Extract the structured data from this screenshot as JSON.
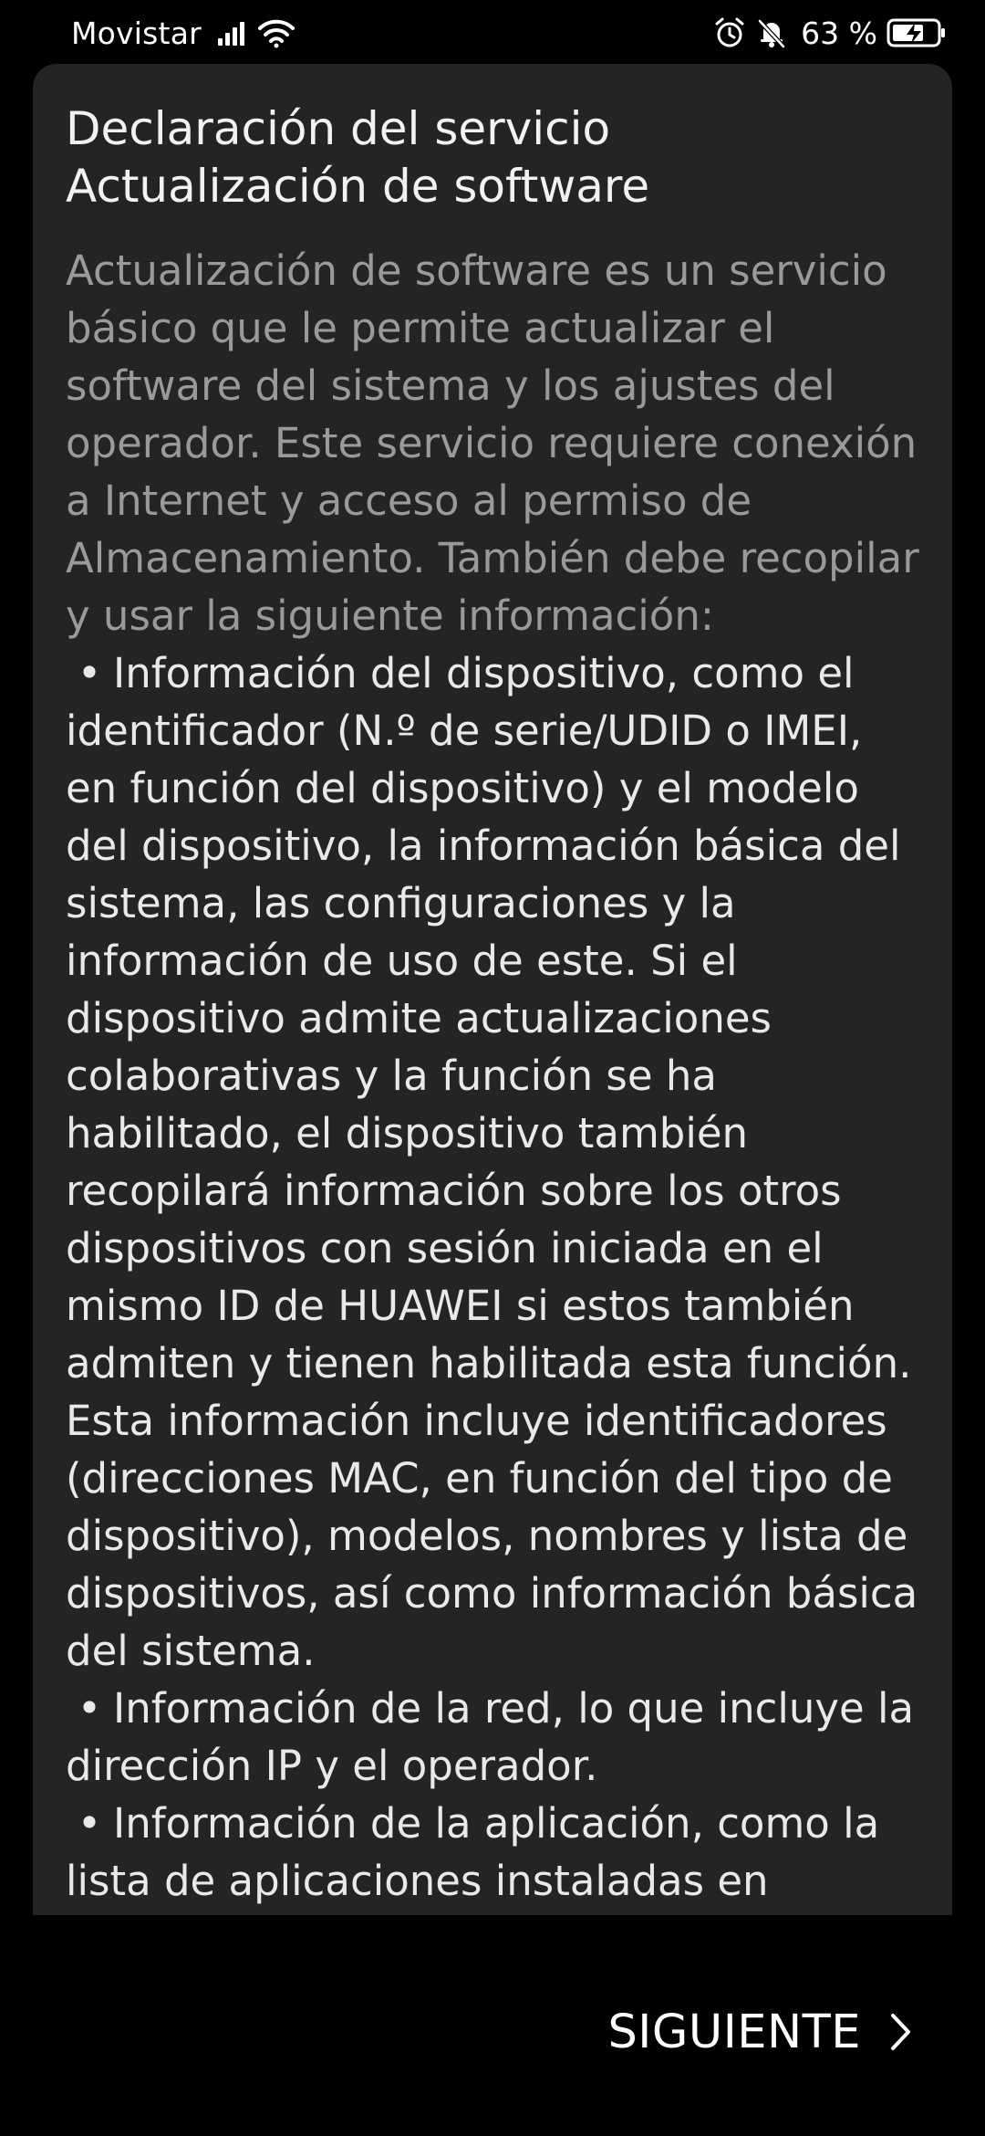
{
  "status_bar": {
    "carrier": "Movistar",
    "battery_percent": "63 %"
  },
  "dialog": {
    "title": "Declaración del servicio\nActualización de software",
    "intro": "Actualización de software es un servicio básico que le permite actualizar el software del sistema y los ajustes del operador. Este servicio requiere conexión a Internet y acceso al permiso de Almacenamiento. También debe recopilar y usar la siguiente información:",
    "bullet_symbol": "•",
    "bullets": [
      "Información del dispositivo, como el identificador (N.º de serie/UDID o IMEI, en función del dispositivo) y el modelo del dispositivo, la información básica del sistema, las configuraciones y la información de uso de este. Si el dispositivo admite actualizaciones colaborativas y la función se ha habilitado, el dispositivo también recopilará información sobre los otros dispositivos con sesión iniciada en el mismo ID de HUAWEI si estos también admiten y tienen habilitada esta función. Esta información incluye identificadores (direcciones MAC, en función del tipo de dispositivo), modelos, nombres y lista de dispositivos, así como información básica del sistema.",
      "Información de la red, lo que incluye la dirección IP y el operador.",
      "Información de la aplicación, como la lista de aplicaciones instaladas en"
    ]
  },
  "footer": {
    "next_label": "SIGUIENTE"
  },
  "icons": {
    "signal": "signal-bars-icon",
    "wifi": "wifi-icon",
    "alarm": "alarm-clock-icon",
    "mute": "bell-off-icon",
    "battery": "battery-charging-icon",
    "next": "chevron-right-icon"
  },
  "colors": {
    "background": "#000000",
    "card": "#232426",
    "intro_text": "#9a9a9a",
    "body_text": "#e9e9e9"
  }
}
